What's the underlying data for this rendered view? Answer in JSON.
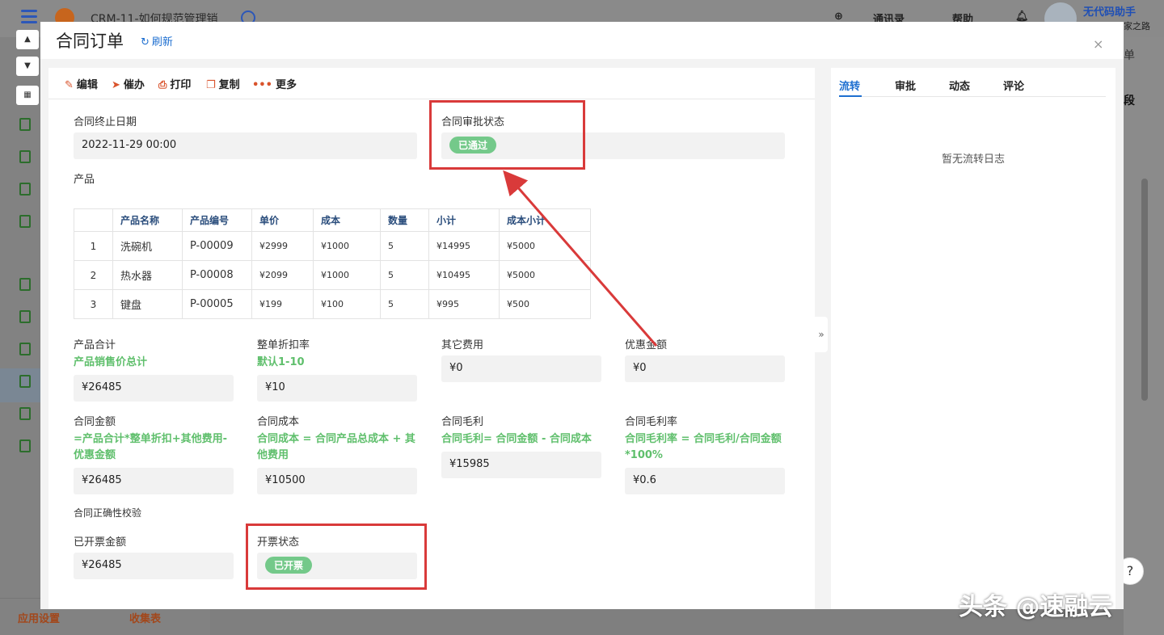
{
  "app": {
    "title": "CRM-11-如何规范管理销",
    "top_contacts": "通讯录",
    "top_help": "帮助",
    "user_name": "无代码助手",
    "user_sub": "家之路",
    "right_text_1": "单",
    "right_text_2": "段",
    "sidebar_bottom_settings": "应用设置",
    "sidebar_bottom_collect": "收集表",
    "help_glyph": "?"
  },
  "modal": {
    "title": "合同订单",
    "refresh_label": "刷新",
    "close_glyph": "×"
  },
  "toolbar": {
    "edit": "编辑",
    "urge": "催办",
    "print": "打印",
    "copy": "复制",
    "more": "更多"
  },
  "form": {
    "end_date_label": "合同终止日期",
    "end_date_value": "2022-11-29 00:00",
    "approval_label": "合同审批状态",
    "approval_value": "已通过",
    "products_label": "产品",
    "product_total_label": "产品合计",
    "product_total_hint": "产品销售价总计",
    "product_total_value": "¥26485",
    "discount_label": "整单折扣率",
    "discount_hint": "默认1-10",
    "discount_value": "¥10",
    "other_fee_label": "其它费用",
    "other_fee_value": "¥0",
    "coupon_label": "优惠金额",
    "coupon_value": "¥0",
    "contract_amount_label": "合同金额",
    "contract_amount_hint": "=产品合计*整单折扣+其他费用-优惠金额",
    "contract_amount_value": "¥26485",
    "contract_cost_label": "合同成本",
    "contract_cost_hint": "合同成本 = 合同产品总成本 + 其他费用",
    "contract_cost_value": "¥10500",
    "gross_profit_label": "合同毛利",
    "gross_profit_hint": "合同毛利= 合同金额 - 合同成本",
    "gross_profit_value": "¥15985",
    "gross_margin_label": "合同毛利率",
    "gross_margin_hint": "合同毛利率 = 合同毛利/合同金额*100%",
    "gross_margin_value": "¥0.6",
    "validation_label": "合同正确性校验",
    "invoiced_amount_label": "已开票金额",
    "invoiced_amount_value": "¥26485",
    "invoice_status_label": "开票状态",
    "invoice_status_value": "已开票"
  },
  "product_table": {
    "headers": [
      "产品名称",
      "产品编号",
      "单价",
      "成本",
      "数量",
      "小计",
      "成本小计"
    ],
    "rows": [
      {
        "idx": "1",
        "name": "洗碗机",
        "code": "P-00009",
        "price": "¥2999",
        "cost": "¥1000",
        "qty": "5",
        "subtotal": "¥14995",
        "cost_subtotal": "¥5000"
      },
      {
        "idx": "2",
        "name": "热水器",
        "code": "P-00008",
        "price": "¥2099",
        "cost": "¥1000",
        "qty": "5",
        "subtotal": "¥10495",
        "cost_subtotal": "¥5000"
      },
      {
        "idx": "3",
        "name": "键盘",
        "code": "P-00005",
        "price": "¥199",
        "cost": "¥100",
        "qty": "5",
        "subtotal": "¥995",
        "cost_subtotal": "¥500"
      }
    ]
  },
  "side_panel": {
    "tabs": [
      "流转",
      "审批",
      "动态",
      "评论"
    ],
    "active_tab": "流转",
    "empty_text": "暂无流转日志"
  },
  "annotation": {
    "box_color": "#d93a3a"
  },
  "watermark": "头条 @速融云",
  "colors": {
    "accent": "#1e6fd0",
    "hint_green": "#5fbf6c",
    "tag_green": "#74c98a",
    "toolbar_icon": "#d9532c"
  }
}
